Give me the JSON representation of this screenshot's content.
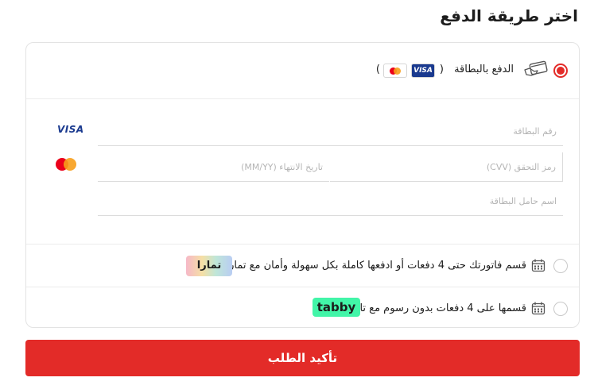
{
  "section_title": "اختر طريقة الدفع",
  "card_option": {
    "label": "الدفع بالبطاقة",
    "paren_open": "(",
    "paren_close": ")",
    "visa_text": "VISA",
    "selected": true
  },
  "card_form": {
    "card_number_placeholder": "رقم البطاقة",
    "expiry_placeholder": "تاريخ الانتهاء (MM/YY)",
    "cvv_placeholder": "رمز التحقق (CVV)",
    "holder_placeholder": "اسم حامل البطاقة",
    "visa_text": "VISA"
  },
  "tamara_option": {
    "label": "قسم فاتورتك حتى 4 دفعات أو ادفعها كاملة بكل سهولة وأمان مع تمارا",
    "logo_text": "تمارا",
    "selected": false
  },
  "tabby_option": {
    "label": "قسمها على 4 دفعات بدون رسوم مع تابي",
    "logo_text": "tabby",
    "selected": false
  },
  "confirm_button_label": "تأكيد الطلب",
  "colors": {
    "accent": "#e32b28",
    "visa_blue": "#1a3a8f",
    "tabby_green": "#42f5a8"
  },
  "icons": {
    "card_option": "hand-card-icon",
    "installments": "calendar-icon"
  }
}
